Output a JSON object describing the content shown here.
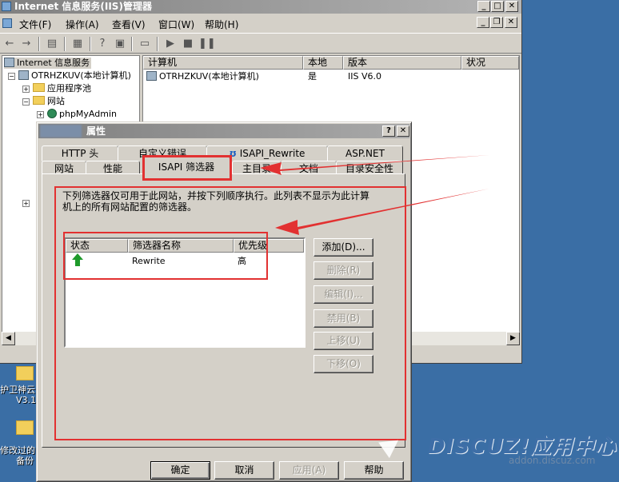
{
  "main_window": {
    "title": "Internet 信息服务(IIS)管理器",
    "menu": [
      "文件(F)",
      "操作(A)",
      "查看(V)",
      "窗口(W)",
      "帮助(H)"
    ],
    "tree": {
      "root": "Internet 信息服务",
      "computer": "OTRHZKUV(本地计算机)",
      "app_pools": "应用程序池",
      "websites": "网站",
      "site1": "phpMyAdmin"
    },
    "list": {
      "columns": [
        "计算机",
        "本地",
        "版本",
        "状况"
      ],
      "row": {
        "computer": "OTRHZKUV(本地计算机)",
        "local": "是",
        "version": "IIS V6.0",
        "status": ""
      }
    }
  },
  "desktop": {
    "label1": "护卫神云",
    "label1b": "V3.1",
    "label2": "修改过的",
    "label2b": "备份"
  },
  "dialog": {
    "title": "属性",
    "help_btn": "?",
    "close_btn": "✕",
    "tabs_row1": [
      "HTTP 头",
      "自定义错误",
      "ISAPI_Rewrite",
      "ASP.NET"
    ],
    "tabs_row2": [
      "网站",
      "性能",
      "ISAPI 筛选器",
      "主目录",
      "文档",
      "目录安全性"
    ],
    "description_line1": "下列筛选器仅可用于此网站，并按下列顺序执行。此列表不显示为此计算",
    "description_line2": "机上的所有网站配置的筛选器。",
    "filter_columns": [
      "状态",
      "筛选器名称",
      "优先级"
    ],
    "filter_rows": [
      {
        "status_icon": "green-up-arrow",
        "name": "Rewrite",
        "priority": "高"
      }
    ],
    "side_buttons": [
      "添加(D)...",
      "删除(R)",
      "编辑(I)...",
      "禁用(B)",
      "上移(U)",
      "下移(O)"
    ],
    "bottom_buttons": [
      "确定",
      "取消",
      "应用(A)",
      "帮助"
    ]
  },
  "watermark": {
    "brand": "DISCUZ!应用中心",
    "sub": "addon.discuz.com"
  },
  "colors": {
    "annotation_red": "#e23131",
    "dialog_face": "#d4d0c8",
    "desktop": "#3a6ea5"
  }
}
